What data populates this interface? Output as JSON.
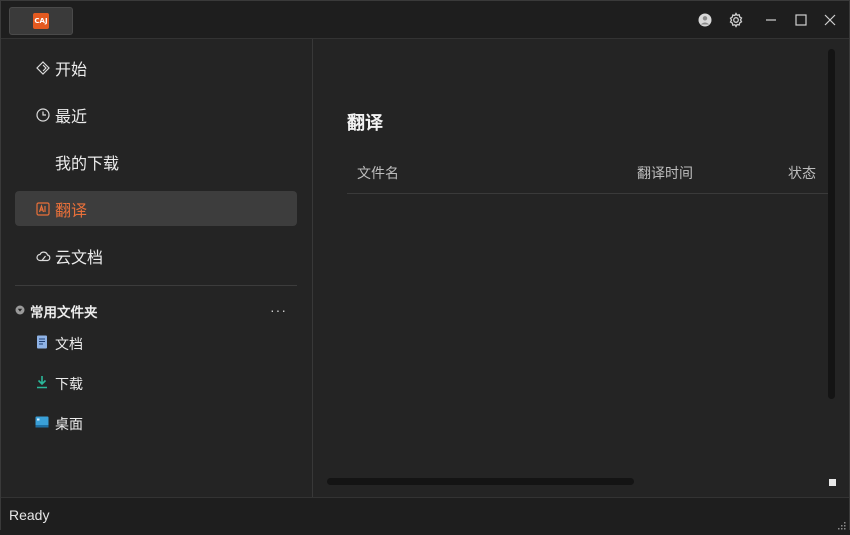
{
  "app": {
    "logo_text": "CAJ",
    "brand_color": "#e45a20",
    "accent_color": "#e8703a"
  },
  "titlebar": {
    "icons": [
      "user-avatar-icon",
      "settings-gear-icon",
      "minimize-icon",
      "maximize-icon",
      "close-icon"
    ]
  },
  "sidebar": {
    "items": [
      {
        "label": "开始",
        "icon": "home-diamond-icon"
      },
      {
        "label": "最近",
        "icon": "clock-icon"
      },
      {
        "label": "我的下载",
        "icon": ""
      },
      {
        "label": "翻译",
        "icon": "translate-icon",
        "active": true
      },
      {
        "label": "云文档",
        "icon": "cloud-icon"
      }
    ],
    "section_title": "常用文件夹",
    "section_more": "···",
    "folders": [
      {
        "label": "文档",
        "icon": "document-icon"
      },
      {
        "label": "下载",
        "icon": "download-icon"
      },
      {
        "label": "桌面",
        "icon": "desktop-icon"
      }
    ]
  },
  "main": {
    "title": "翻译",
    "columns": [
      "文件名",
      "翻译时间",
      "状态"
    ],
    "rows": []
  },
  "status": {
    "text": "Ready"
  }
}
